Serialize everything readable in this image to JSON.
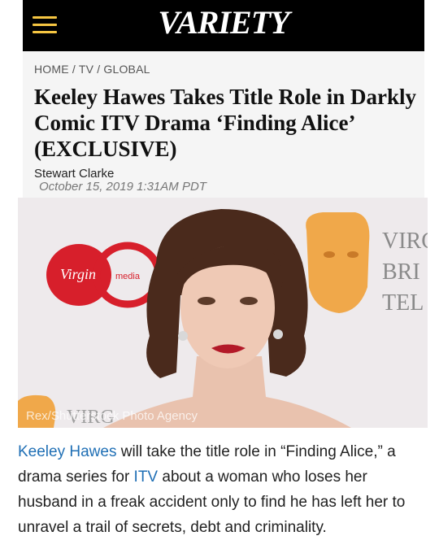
{
  "header": {
    "logo_text": "VARIETY",
    "menu_icon": "hamburger-menu-icon",
    "accent_color": "#f5c542"
  },
  "breadcrumb": "HOME / TV / GLOBAL",
  "article": {
    "headline": "Keeley Hawes Takes Title Role in Darkly Comic ITV Drama ‘Finding Alice’ (EXCLUSIVE)",
    "author": "Stewart Clarke",
    "date": "October 15, 2019 1:31AM PDT",
    "photo_credit": "Rex/Shutterstock Photo Agency",
    "backdrop_text": {
      "virgin_logo": "Virgin",
      "virgin_media": "media",
      "bafta_lines": [
        "VIRG",
        "BRI",
        "TEL"
      ],
      "bottom_text": "VIRG"
    },
    "body": {
      "link1": "Keeley Hawes",
      "text1": " will take the title role in “Finding Alice,” a drama series for ",
      "link2": "ITV",
      "text2": " about a woman who loses her husband in a freak accident only to find he has left her to unravel a trail of secrets, debt and criminality."
    }
  }
}
